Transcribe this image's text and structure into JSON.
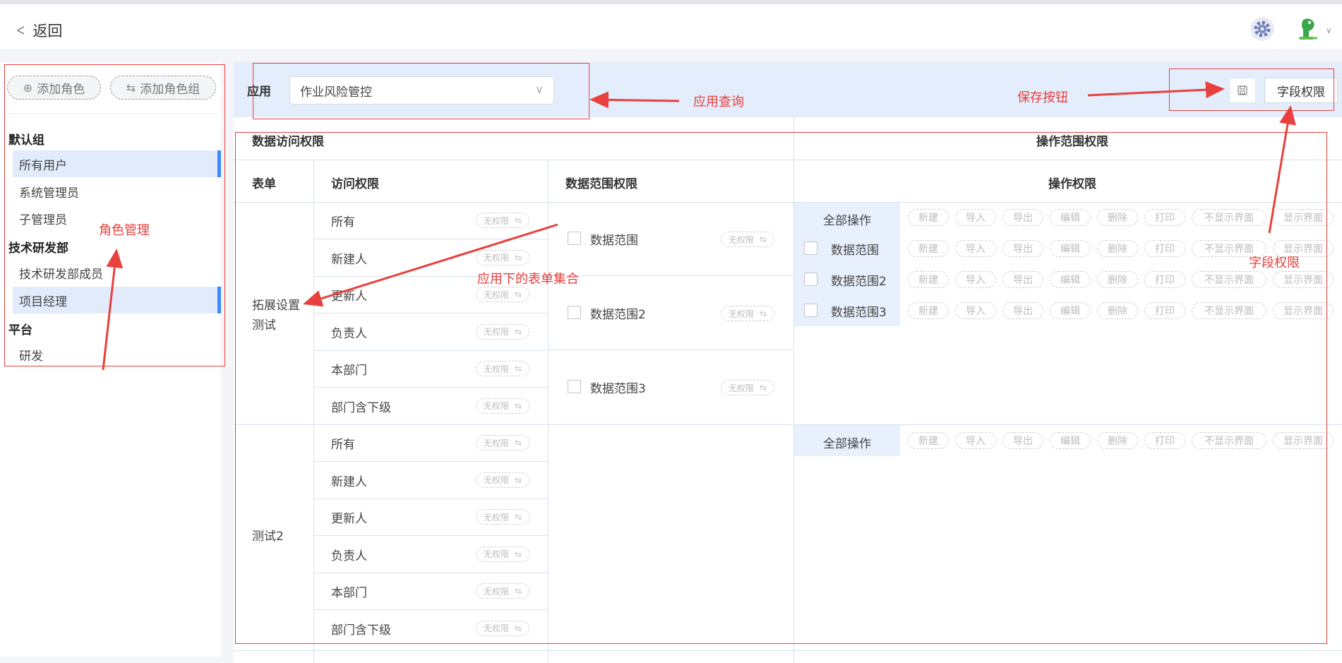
{
  "header": {
    "back_label": "返回"
  },
  "sidebar": {
    "add_role_label": "添加角色",
    "add_role_group_label": "添加角色组",
    "groups": [
      {
        "name": "默认组",
        "roles": [
          {
            "label": "所有用户",
            "active": true
          },
          {
            "label": "系统管理员",
            "active": false
          },
          {
            "label": "子管理员",
            "active": false
          }
        ]
      },
      {
        "name": "技术研发部",
        "roles": [
          {
            "label": "技术研发部成员",
            "active": false
          },
          {
            "label": "项目经理",
            "active": true
          }
        ]
      },
      {
        "name": "平台",
        "roles": [
          {
            "label": "研发",
            "active": false
          }
        ]
      }
    ]
  },
  "toolbar": {
    "app_label": "应用",
    "app_value": "作业风险管控",
    "field_permission_label": "字段权限"
  },
  "table": {
    "section_data_access": "数据访问权限",
    "section_operation_scope": "操作范围权限",
    "col_form": "表单",
    "col_access": "访问权限",
    "col_data_scope": "数据范围权限",
    "col_operation": "操作权限",
    "no_permission": "无权限",
    "all_operations": "全部操作",
    "operations": [
      "新建",
      "导入",
      "导出",
      "编辑",
      "删除",
      "打印",
      "不显示界面",
      "显示界面"
    ],
    "forms": [
      {
        "name": "拓展设置测试",
        "access": [
          "所有",
          "新建人",
          "更新人",
          "负责人",
          "本部门",
          "部门含下级"
        ],
        "scopes": [
          "数据范围",
          "数据范围2",
          "数据范围3"
        ]
      },
      {
        "name": "测试2",
        "access": [
          "所有",
          "新建人",
          "更新人",
          "负责人",
          "本部门",
          "部门含下级"
        ],
        "scopes": []
      }
    ]
  },
  "annotations": {
    "role_mgmt": "角色管理",
    "app_query": "应用查询",
    "save_button": "保存按钮",
    "field_permission": "字段权限",
    "form_collection": "应用下的表单集合"
  },
  "colors": {
    "accent": "#3d8bff",
    "annotation": "#e8403c",
    "selected_bg": "#e1ebfc"
  }
}
